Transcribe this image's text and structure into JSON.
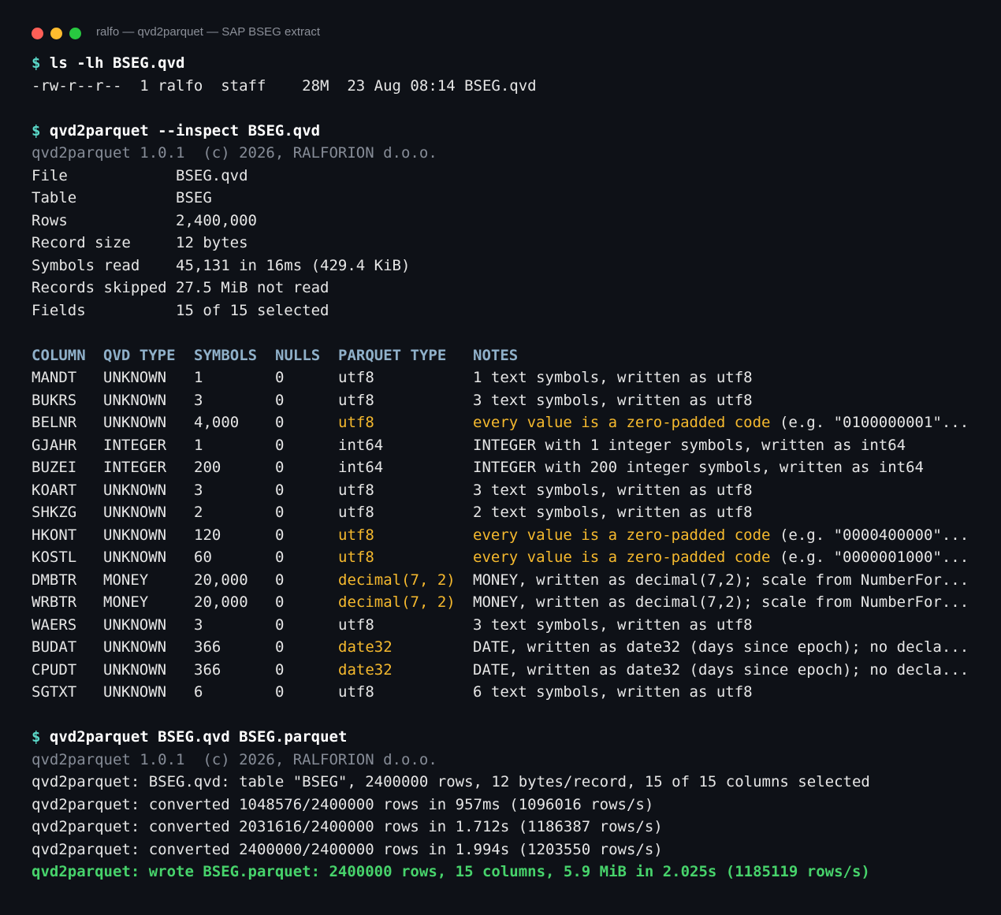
{
  "window": {
    "title": "ralfo — qvd2parquet — SAP BSEG extract"
  },
  "prompt": "$",
  "ls": {
    "command": "ls -lh BSEG.qvd",
    "output": "-rw-r--r--  1 ralfo  staff    28M  23 Aug 08:14 BSEG.qvd"
  },
  "inspect": {
    "command": "qvd2parquet --inspect BSEG.qvd",
    "banner": "qvd2parquet 1.0.1  (c) 2026, RALFORION d.o.o.",
    "info": [
      {
        "key": "File",
        "value": "BSEG.qvd"
      },
      {
        "key": "Table",
        "value": "BSEG"
      },
      {
        "key": "Rows",
        "value": "2,400,000"
      },
      {
        "key": "Record size",
        "value": "12 bytes"
      },
      {
        "key": "Symbols read",
        "value": "45,131 in 16ms (429.4 KiB)"
      },
      {
        "key": "Records skipped",
        "value": "27.5 MiB not read"
      },
      {
        "key": "Fields",
        "value": "15 of 15 selected"
      }
    ],
    "headers": [
      "COLUMN",
      "QVD TYPE",
      "SYMBOLS",
      "NULLS",
      "PARQUET TYPE",
      "NOTES"
    ],
    "rows": [
      {
        "column": "MANDT",
        "qvd_type": "UNKNOWN",
        "symbols": "1",
        "nulls": "0",
        "parquet_type": "utf8",
        "note_hl": "",
        "note": "1 text symbols, written as utf8",
        "highlight_type": false
      },
      {
        "column": "BUKRS",
        "qvd_type": "UNKNOWN",
        "symbols": "3",
        "nulls": "0",
        "parquet_type": "utf8",
        "note_hl": "",
        "note": "3 text symbols, written as utf8",
        "highlight_type": false
      },
      {
        "column": "BELNR",
        "qvd_type": "UNKNOWN",
        "symbols": "4,000",
        "nulls": "0",
        "parquet_type": "utf8",
        "note_hl": "every value is a zero-padded code",
        "note": " (e.g. \"0100000001\"...",
        "highlight_type": true
      },
      {
        "column": "GJAHR",
        "qvd_type": "INTEGER",
        "symbols": "1",
        "nulls": "0",
        "parquet_type": "int64",
        "note_hl": "",
        "note": "INTEGER with 1 integer symbols, written as int64",
        "highlight_type": false
      },
      {
        "column": "BUZEI",
        "qvd_type": "INTEGER",
        "symbols": "200",
        "nulls": "0",
        "parquet_type": "int64",
        "note_hl": "",
        "note": "INTEGER with 200 integer symbols, written as int64",
        "highlight_type": false
      },
      {
        "column": "KOART",
        "qvd_type": "UNKNOWN",
        "symbols": "3",
        "nulls": "0",
        "parquet_type": "utf8",
        "note_hl": "",
        "note": "3 text symbols, written as utf8",
        "highlight_type": false
      },
      {
        "column": "SHKZG",
        "qvd_type": "UNKNOWN",
        "symbols": "2",
        "nulls": "0",
        "parquet_type": "utf8",
        "note_hl": "",
        "note": "2 text symbols, written as utf8",
        "highlight_type": false
      },
      {
        "column": "HKONT",
        "qvd_type": "UNKNOWN",
        "symbols": "120",
        "nulls": "0",
        "parquet_type": "utf8",
        "note_hl": "every value is a zero-padded code",
        "note": " (e.g. \"0000400000\"...",
        "highlight_type": true
      },
      {
        "column": "KOSTL",
        "qvd_type": "UNKNOWN",
        "symbols": "60",
        "nulls": "0",
        "parquet_type": "utf8",
        "note_hl": "every value is a zero-padded code",
        "note": " (e.g. \"0000001000\"...",
        "highlight_type": true
      },
      {
        "column": "DMBTR",
        "qvd_type": "MONEY",
        "symbols": "20,000",
        "nulls": "0",
        "parquet_type": "decimal(7, 2)",
        "note_hl": "",
        "note": "MONEY, written as decimal(7,2); scale from NumberFor...",
        "highlight_type": true
      },
      {
        "column": "WRBTR",
        "qvd_type": "MONEY",
        "symbols": "20,000",
        "nulls": "0",
        "parquet_type": "decimal(7, 2)",
        "note_hl": "",
        "note": "MONEY, written as decimal(7,2); scale from NumberFor...",
        "highlight_type": true
      },
      {
        "column": "WAERS",
        "qvd_type": "UNKNOWN",
        "symbols": "3",
        "nulls": "0",
        "parquet_type": "utf8",
        "note_hl": "",
        "note": "3 text symbols, written as utf8",
        "highlight_type": false
      },
      {
        "column": "BUDAT",
        "qvd_type": "UNKNOWN",
        "symbols": "366",
        "nulls": "0",
        "parquet_type": "date32",
        "note_hl": "",
        "note": "DATE, written as date32 (days since epoch); no decla...",
        "highlight_type": true
      },
      {
        "column": "CPUDT",
        "qvd_type": "UNKNOWN",
        "symbols": "366",
        "nulls": "0",
        "parquet_type": "date32",
        "note_hl": "",
        "note": "DATE, written as date32 (days since epoch); no decla...",
        "highlight_type": true
      },
      {
        "column": "SGTXT",
        "qvd_type": "UNKNOWN",
        "symbols": "6",
        "nulls": "0",
        "parquet_type": "utf8",
        "note_hl": "",
        "note": "6 text symbols, written as utf8",
        "highlight_type": false
      }
    ]
  },
  "convert": {
    "command": "qvd2parquet BSEG.qvd BSEG.parquet",
    "banner": "qvd2parquet 1.0.1  (c) 2026, RALFORION d.o.o.",
    "lines": [
      "qvd2parquet: BSEG.qvd: table \"BSEG\", 2400000 rows, 12 bytes/record, 15 of 15 columns selected",
      "qvd2parquet: converted 1048576/2400000 rows in 957ms (1096016 rows/s)",
      "qvd2parquet: converted 2031616/2400000 rows in 1.712s (1186387 rows/s)",
      "qvd2parquet: converted 2400000/2400000 rows in 1.994s (1203550 rows/s)"
    ],
    "result": "qvd2parquet: wrote BSEG.parquet: 2400000 rows, 15 columns, 5.9 MiB in 2.025s (1185119 rows/s)"
  },
  "colors": {
    "background": "#0e1117",
    "prompt": "#5ad8c8",
    "warning": "#f5b92e",
    "success": "#47d36b",
    "dim": "#868c97"
  }
}
